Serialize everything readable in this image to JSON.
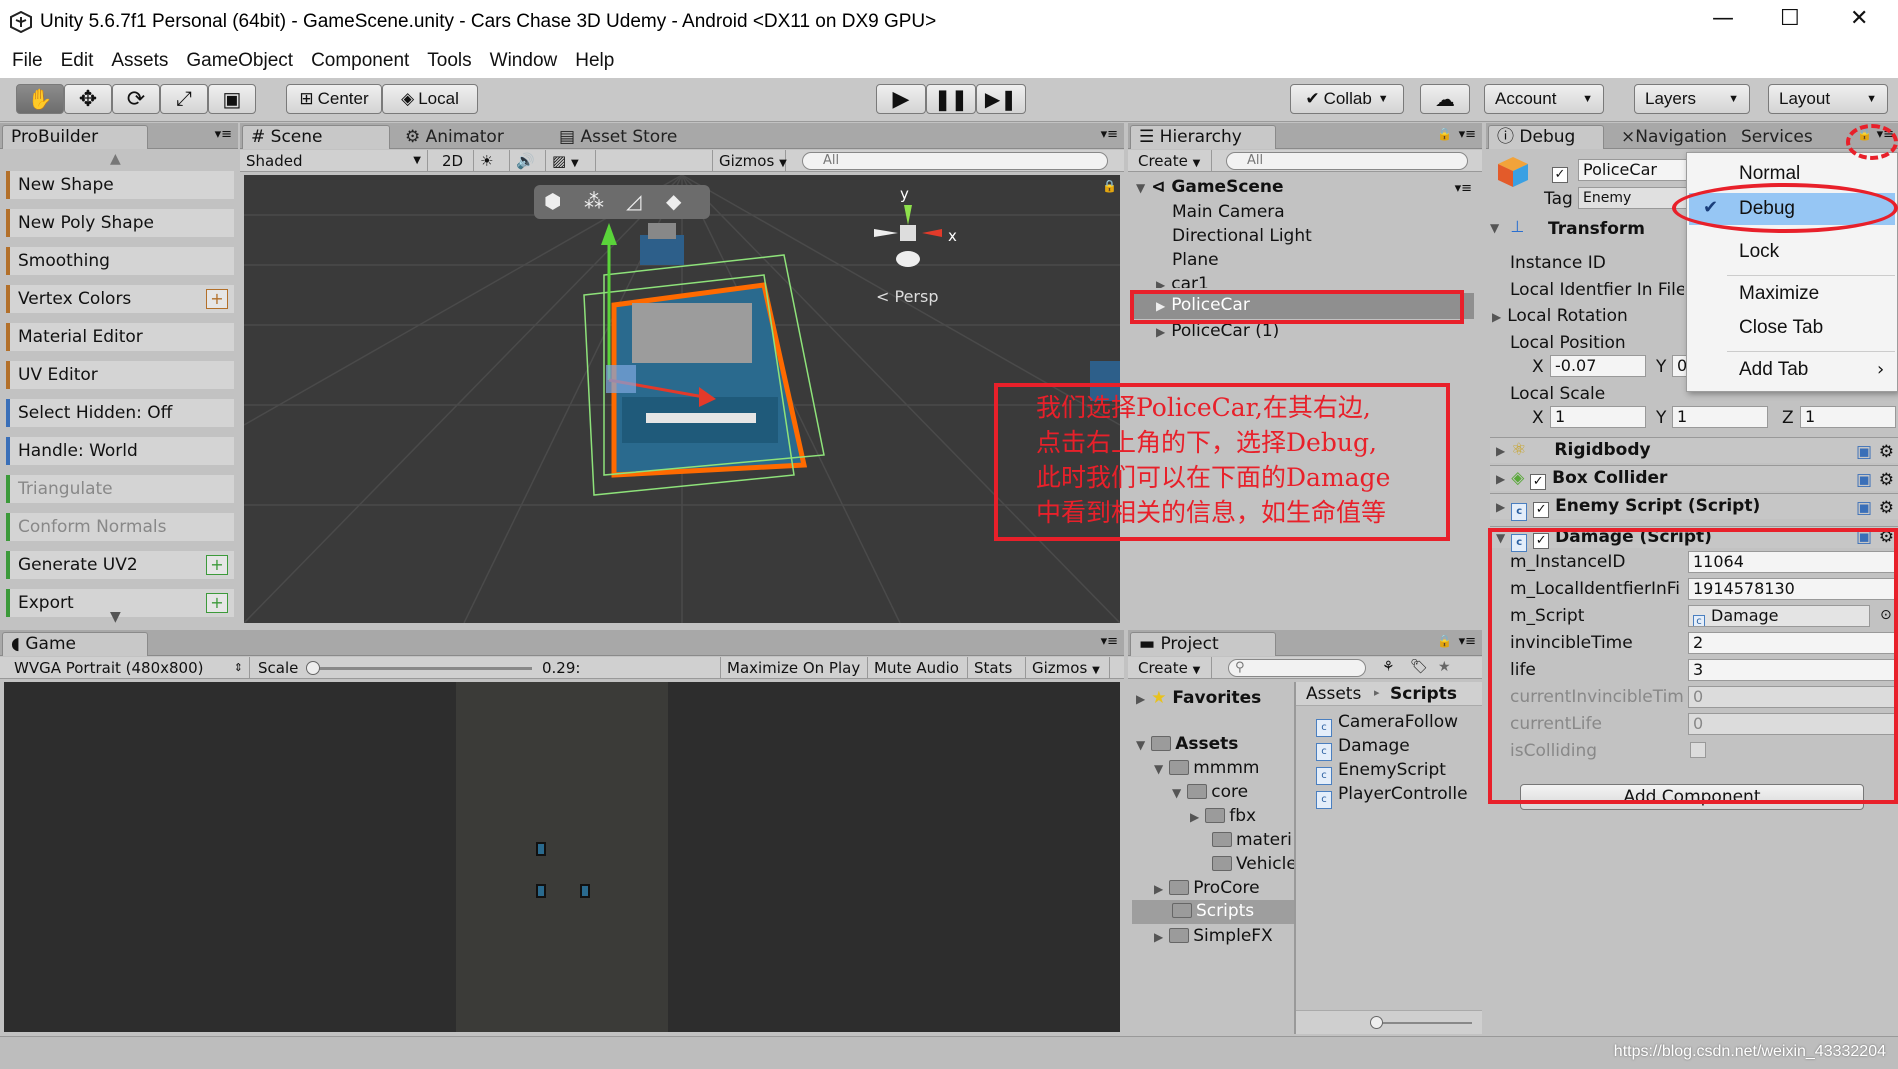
{
  "window": {
    "title": "Unity 5.6.7f1 Personal (64bit) - GameScene.unity - Cars Chase 3D Udemy - Android <DX11 on DX9 GPU>",
    "minimize": "—",
    "maximize": "☐",
    "close": "✕"
  },
  "menu": [
    "File",
    "Edit",
    "Assets",
    "GameObject",
    "Component",
    "Tools",
    "Window",
    "Help"
  ],
  "toolbar": {
    "center_label": "Center",
    "local_label": "Local",
    "collab_label": "Collab",
    "account_label": "Account",
    "layers_label": "Layers",
    "layout_label": "Layout"
  },
  "probuilder": {
    "tab": "ProBuilder",
    "items": [
      {
        "label": "New Shape"
      },
      {
        "label": "New Poly Shape"
      },
      {
        "label": "Smoothing"
      },
      {
        "label": "Vertex Colors",
        "plus": "+"
      },
      {
        "label": "Material Editor"
      },
      {
        "label": "UV Editor"
      },
      {
        "label": "Select Hidden: Off"
      },
      {
        "label": "Handle: World"
      },
      {
        "label": "Triangulate"
      },
      {
        "label": "Conform Normals"
      },
      {
        "label": "Generate UV2",
        "plus": "+"
      },
      {
        "label": "Export",
        "plus": "+"
      }
    ]
  },
  "scene": {
    "tabs": [
      "Scene",
      "Animator",
      "Asset Store"
    ],
    "shaded": "Shaded",
    "mode_2d": "2D",
    "gizmos": "Gizmos",
    "search": "All",
    "persp": "Persp",
    "axis_y": "y",
    "axis_x": "x"
  },
  "game": {
    "tab": "Game",
    "resolution": "WVGA Portrait (480x800)",
    "scale_label": "Scale",
    "scale_value": "0.29:",
    "buttons": [
      "Maximize On Play",
      "Mute Audio",
      "Stats",
      "Gizmos"
    ]
  },
  "hierarchy": {
    "tab": "Hierarchy",
    "create": "Create",
    "search": "All",
    "scene_name": "GameScene",
    "items": [
      "Main Camera",
      "Directional Light",
      "Plane",
      "car1",
      "PoliceCar",
      "PoliceCar (1)"
    ]
  },
  "project": {
    "tab": "Project",
    "create": "Create",
    "favorites": "Favorites",
    "assets_root": "Assets",
    "tree": [
      "mmmm",
      "core",
      "fbx",
      "materi",
      "Vehicle",
      "ProCore",
      "Scripts",
      "SimpleFX"
    ],
    "breadcrumb_root": "Assets",
    "breadcrumb_current": "Scripts",
    "files": [
      "CameraFollow",
      "Damage",
      "EnemyScript",
      "PlayerControlle"
    ]
  },
  "inspector": {
    "tabs": [
      "Debug",
      "Navigation",
      "Services"
    ],
    "object_name": "PoliceCar",
    "tag_label": "Tag",
    "tag_value": "Enemy",
    "transform": {
      "title": "Transform",
      "instance_id": "Instance ID",
      "local_identifier": "Local Identfier In File",
      "local_rotation": "Local Rotation",
      "local_position": "Local Position",
      "pos_x_label": "X",
      "pos_x": "-0.07",
      "pos_y_label": "Y",
      "pos_y": "0",
      "local_scale": "Local Scale",
      "scale_x_label": "X",
      "scale_x": "1",
      "scale_y_label": "Y",
      "scale_y": "1",
      "scale_z_label": "Z",
      "scale_z": "1"
    },
    "components": [
      "Rigidbody",
      "Box Collider",
      "Enemy Script (Script)"
    ],
    "damage": {
      "title": "Damage (Script)",
      "fields": [
        {
          "label": "m_InstanceID",
          "value": "11064"
        },
        {
          "label": "m_LocalIdentfierInFi",
          "value": "1914578130"
        },
        {
          "label": "m_Script",
          "value": "Damage"
        },
        {
          "label": "invincibleTime",
          "value": "2"
        },
        {
          "label": "life",
          "value": "3"
        },
        {
          "label": "currentInvincibleTim",
          "value": "0"
        },
        {
          "label": "currentLife",
          "value": "0"
        },
        {
          "label": "isColliding",
          "value": ""
        }
      ]
    },
    "add_component": "Add Component"
  },
  "context_menu": {
    "items": [
      "Normal",
      "Debug",
      "Lock",
      "Maximize",
      "Close Tab",
      "Add Tab"
    ],
    "checked": "Debug"
  },
  "annotation": {
    "lines": [
      "我们选择PoliceCar,在其右边,",
      "点击右上角的下，选择Debug,",
      "此时我们可以在下面的Damage",
      "中看到相关的信息，如生命值等"
    ]
  },
  "watermark": "https://blog.csdn.net/weixin_43332204",
  "colors": {
    "annotation_red": "#e8202a",
    "selection_blue": "#3d87e6",
    "probuilder_orange": "#b3702a"
  }
}
